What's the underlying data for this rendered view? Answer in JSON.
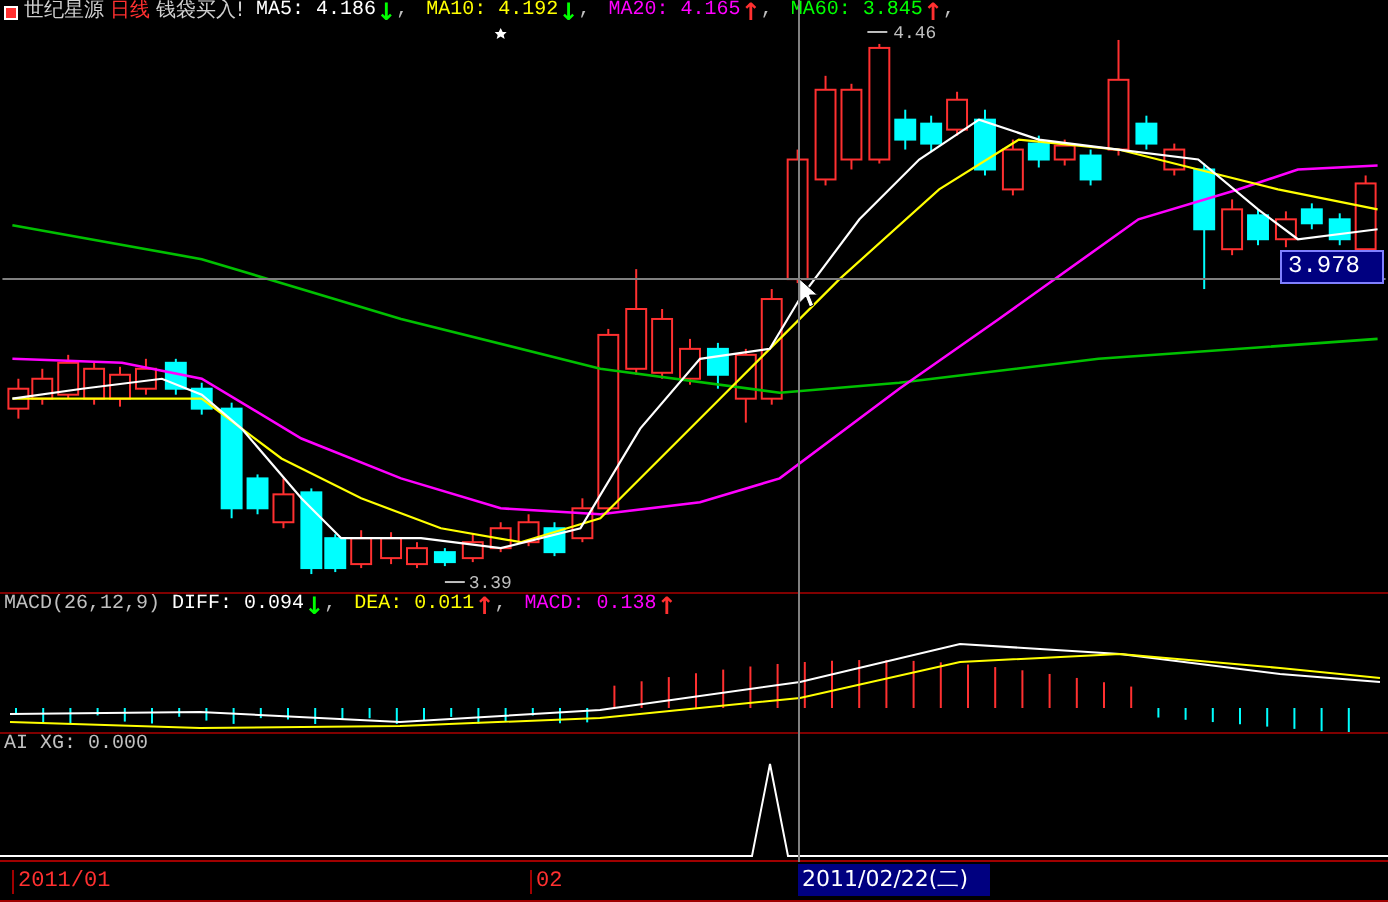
{
  "stock": {
    "name": "世纪星源",
    "period": "日线",
    "signal": "钱袋买入!"
  },
  "ma_legend": [
    {
      "label": "MA5:",
      "value": "4.186",
      "arrow": {
        "text": "↓",
        "color": "#00ff00"
      },
      "color": "#ffffff",
      "separator": ","
    },
    {
      "label": "MA10:",
      "value": "4.192",
      "arrow": {
        "text": "↓",
        "color": "#00ff00"
      },
      "color": "#ffff00",
      "separator": ","
    },
    {
      "label": "MA20:",
      "value": "4.165",
      "arrow": {
        "text": "↑",
        "color": "#ff3030"
      },
      "color": "#ff00ff",
      "separator": ","
    },
    {
      "label": "MA60:",
      "value": "3.845",
      "arrow": {
        "text": "↑",
        "color": "#ff3030"
      },
      "color": "#00ff00",
      "separator": ","
    }
  ],
  "price_labels": {
    "high": "4.46",
    "low": "3.39"
  },
  "crosshair": {
    "price": "3.978",
    "date": "2011/02/22(二)"
  },
  "macd": {
    "title": "MACD(26,12,9)",
    "legend": [
      {
        "label": "DIFF:",
        "value": "0.094",
        "arrow": {
          "text": "↓",
          "color": "#00ff00"
        },
        "color": "#ffffff",
        "separator": ","
      },
      {
        "label": "DEA:",
        "value": "0.011",
        "arrow": {
          "text": "↑",
          "color": "#ff3030"
        },
        "color": "#ffff00",
        "separator": ","
      },
      {
        "label": "MACD:",
        "value": "0.138",
        "arrow": {
          "text": "↑",
          "color": "#ff3030"
        },
        "color": "#ff00ff"
      }
    ]
  },
  "ai": {
    "title": "AI",
    "legend": [
      {
        "label": "XG:",
        "value": "0.000"
      }
    ]
  },
  "time_axis": [
    {
      "label": "2011/01"
    },
    {
      "label": "02"
    }
  ]
}
